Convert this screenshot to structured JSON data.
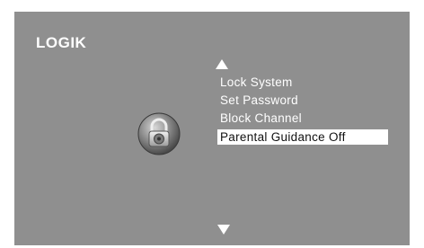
{
  "brand": {
    "logo_text": "LOGIK"
  },
  "icons": {
    "lock": "padlock-icon",
    "scroll_up": "triangle-up-icon",
    "scroll_down": "triangle-down-icon"
  },
  "menu": {
    "items": [
      {
        "label": "Lock System",
        "selected": false
      },
      {
        "label": "Set Password",
        "selected": false
      },
      {
        "label": "Block Channel",
        "selected": false
      },
      {
        "label": "Parental Guidance Off",
        "selected": true
      }
    ]
  },
  "colors": {
    "background": "#8f8f8f",
    "text": "#ffffff",
    "highlight_bg": "#ffffff",
    "highlight_text": "#111111"
  }
}
